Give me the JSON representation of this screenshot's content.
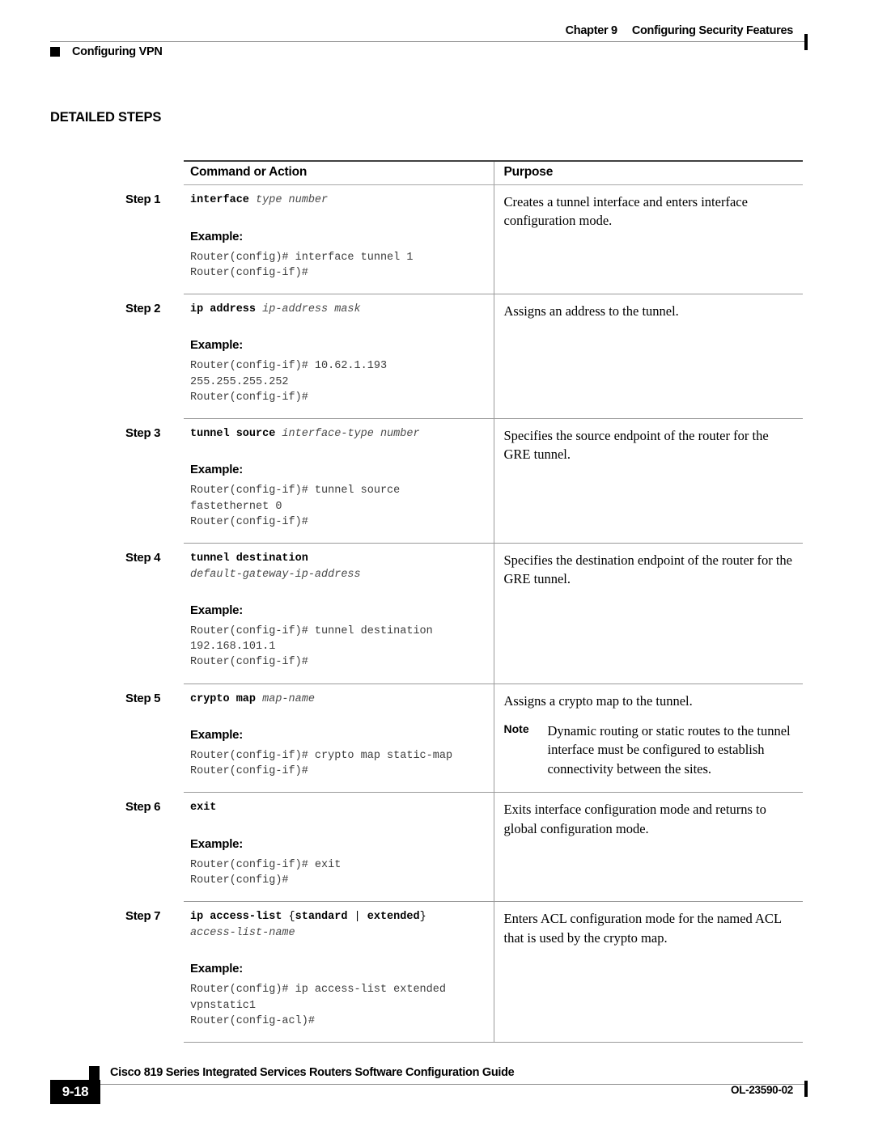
{
  "header": {
    "chapter": "Chapter 9",
    "chapter_title": "Configuring Security Features",
    "section": "Configuring VPN"
  },
  "section_heading": "DETAILED STEPS",
  "table": {
    "columns": [
      "Command or Action",
      "Purpose"
    ],
    "example_label": "Example:",
    "rows": [
      {
        "step": "Step 1",
        "syntax_bold": "interface",
        "syntax_italic": " type number",
        "example": "Router(config)# interface tunnel 1\nRouter(config-if)#",
        "purpose": "Creates a tunnel interface and enters interface configuration mode."
      },
      {
        "step": "Step 2",
        "syntax_bold": "ip address",
        "syntax_italic": " ip-address mask",
        "example": "Router(config-if)# 10.62.1.193\n255.255.255.252\nRouter(config-if)#",
        "purpose": "Assigns an address to the tunnel."
      },
      {
        "step": "Step 3",
        "syntax_bold": "tunnel source",
        "syntax_italic": " interface-type number",
        "example": "Router(config-if)# tunnel source\nfastethernet 0\nRouter(config-if)#",
        "purpose": "Specifies the source endpoint of the router for the GRE tunnel."
      },
      {
        "step": "Step 4",
        "syntax_bold": "tunnel destination",
        "syntax_italic": "default-gateway-ip-address",
        "example": "Router(config-if)# tunnel destination\n192.168.101.1\nRouter(config-if)#",
        "purpose": "Specifies the destination endpoint of the router for the GRE tunnel."
      },
      {
        "step": "Step 5",
        "syntax_bold": "crypto map",
        "syntax_italic": " map-name",
        "example": "Router(config-if)# crypto map static-map\nRouter(config-if)#",
        "purpose": "Assigns a crypto map to the tunnel.",
        "note_label": "Note",
        "note_text": "Dynamic routing or static routes to the tunnel interface must be configured to establish connectivity between the sites."
      },
      {
        "step": "Step 6",
        "syntax_bold": "exit",
        "syntax_italic": "",
        "example": "Router(config-if)# exit\nRouter(config)#",
        "purpose": "Exits interface configuration mode and returns to global configuration mode."
      },
      {
        "step": "Step 7",
        "syntax_bold": "ip access-list",
        "syntax_brace_open": " {",
        "syntax_kw1": "standard",
        "syntax_pipe": " | ",
        "syntax_kw2": "extended",
        "syntax_brace_close": "}",
        "syntax_italic": "access-list-name",
        "example": "Router(config)# ip access-list extended\nvpnstatic1\nRouter(config-acl)#",
        "purpose": "Enters ACL configuration mode for the named ACL that is used by the crypto map."
      }
    ]
  },
  "footer": {
    "page_number": "9-18",
    "doc_title": "Cisco 819 Series Integrated Services Routers Software Configuration Guide",
    "doc_id": "OL-23590-02"
  }
}
